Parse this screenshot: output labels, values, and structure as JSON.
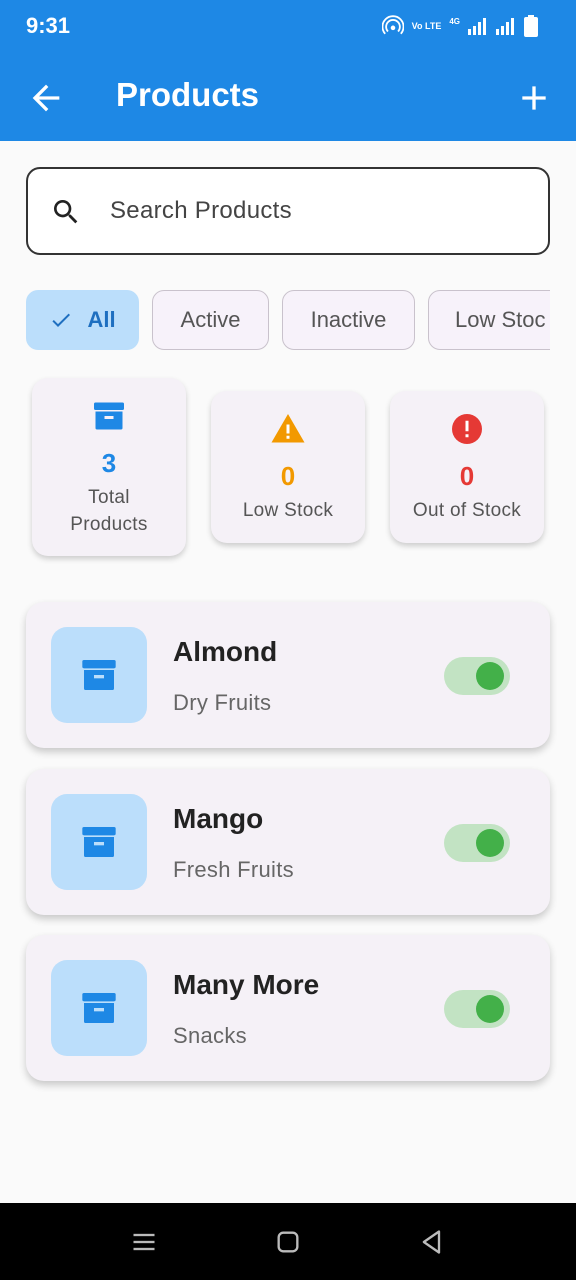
{
  "status_bar": {
    "time": "9:31",
    "network_label": "Vo LTE",
    "network_gen": "4G"
  },
  "app_bar": {
    "title": "Products"
  },
  "search": {
    "placeholder": "Search Products"
  },
  "filters": [
    {
      "label": "All",
      "selected": true
    },
    {
      "label": "Active",
      "selected": false
    },
    {
      "label": "Inactive",
      "selected": false
    },
    {
      "label": "Low Stoc",
      "selected": false
    }
  ],
  "stats": [
    {
      "icon": "inventory-box-icon",
      "value": "3",
      "label_line1": "Total",
      "label_line2": "Products",
      "color": "#1e88e5"
    },
    {
      "icon": "warning-icon",
      "value": "0",
      "label": "Low Stock",
      "color": "#f29900"
    },
    {
      "icon": "error-icon",
      "value": "0",
      "label": "Out of Stock",
      "color": "#e53935"
    }
  ],
  "products": [
    {
      "name": "Almond",
      "category": "Dry Fruits",
      "active": true
    },
    {
      "name": "Mango",
      "category": "Fresh Fruits",
      "active": true
    },
    {
      "name": "Many More",
      "category": "Snacks",
      "active": true
    }
  ],
  "colors": {
    "primary": "#1e88e5",
    "chip_selected_bg": "#bbdefb",
    "toggle_on": "#43b049",
    "warning": "#f29900",
    "danger": "#e53935"
  }
}
